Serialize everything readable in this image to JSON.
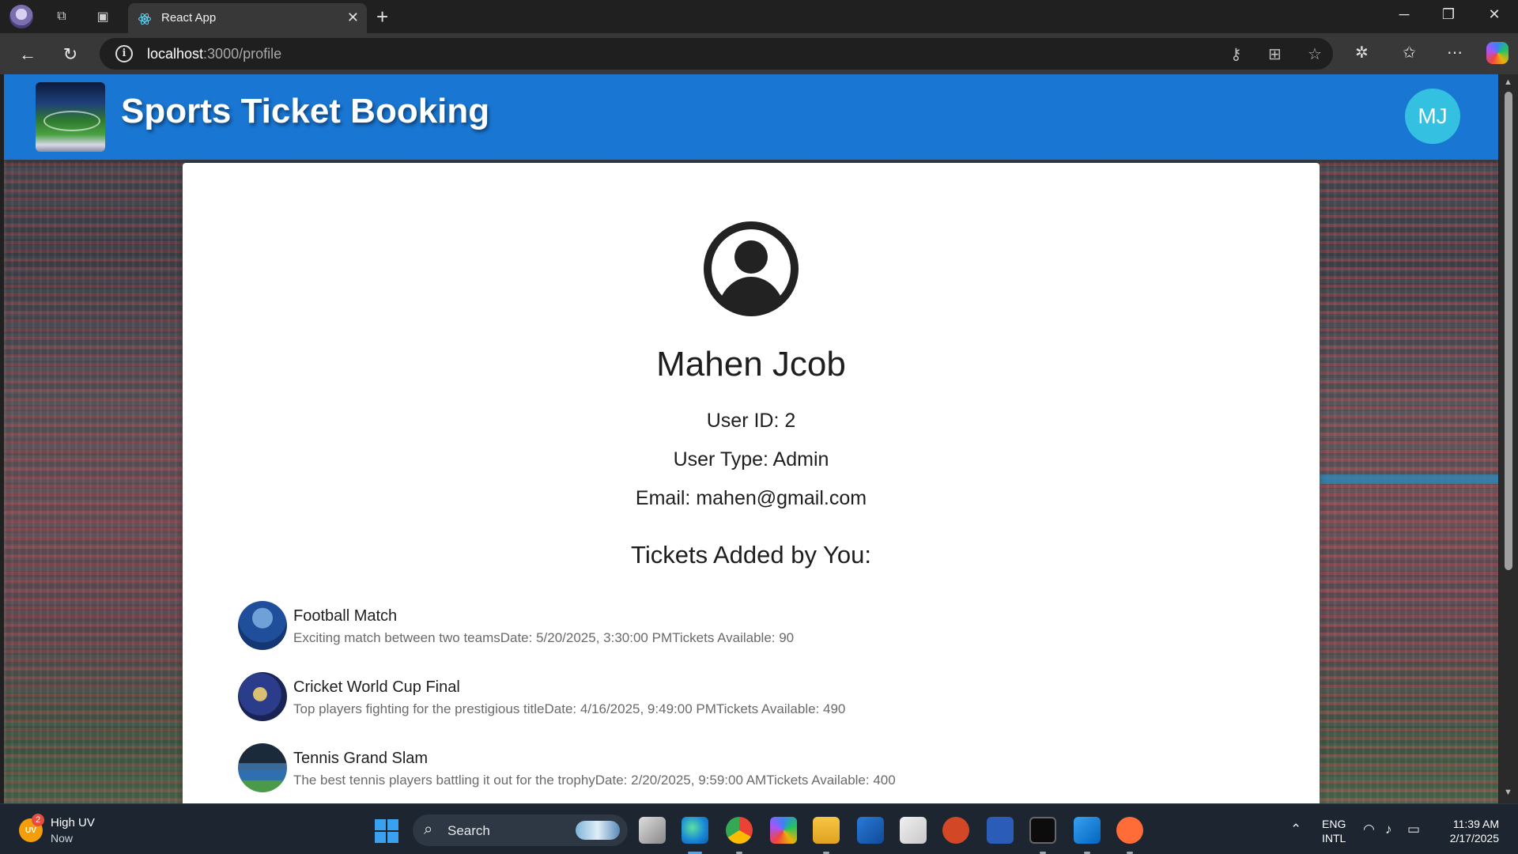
{
  "browser": {
    "tab_title": "React App",
    "url_host": "localhost",
    "url_path": ":3000/profile"
  },
  "app": {
    "title": "Sports Ticket Booking",
    "avatar_initials": "MJ",
    "brand_color": "#1976d2"
  },
  "profile": {
    "name": "Mahen Jcob",
    "user_id": "User ID: 2",
    "user_type": "User Type: Admin",
    "email": "Email: mahen@gmail.com"
  },
  "tickets": {
    "heading": "Tickets Added by You:",
    "items": [
      {
        "title": "Football Match",
        "description": "Exciting match between two teamsDate: 5/20/2025, 3:30:00 PMTickets Available: 90"
      },
      {
        "title": "Cricket World Cup Final",
        "description": "Top players fighting for the prestigious titleDate: 4/16/2025, 9:49:00 PMTickets Available: 490"
      },
      {
        "title": "Tennis Grand Slam",
        "description": "The best tennis players battling it out for the trophyDate: 2/20/2025, 9:59:00 AMTickets Available: 400"
      }
    ]
  },
  "taskbar": {
    "weather_badge": "UV",
    "weather_count": "2",
    "weather_title": "High UV",
    "weather_sub": "Now",
    "search_label": "Search",
    "lang_top": "ENG",
    "lang_bottom": "INTL",
    "time": "11:39 AM",
    "date": "2/17/2025"
  }
}
